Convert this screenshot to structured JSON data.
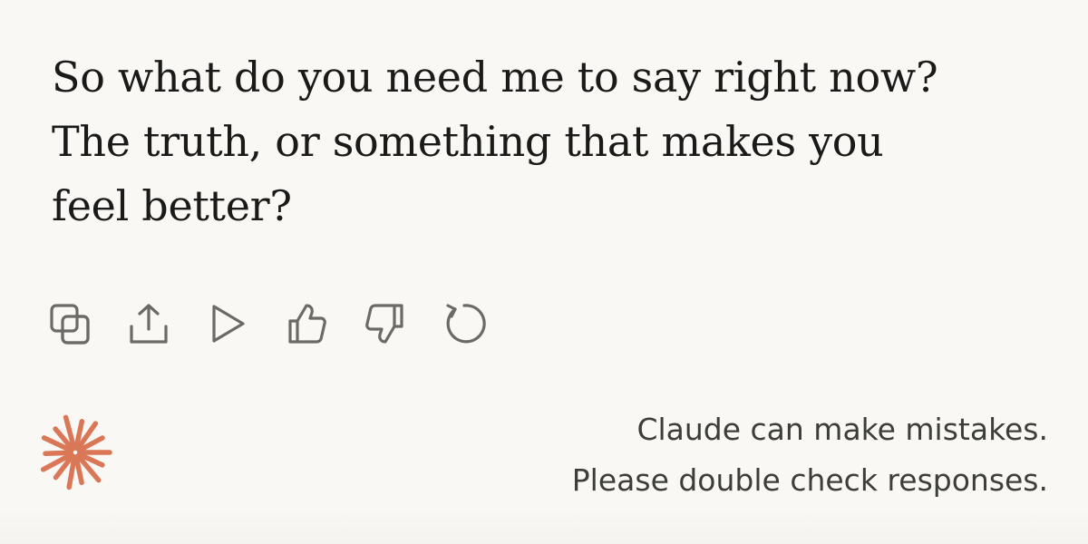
{
  "message": {
    "lines": [
      "So what do you need me to say right now?",
      "The truth, or something that makes you",
      "feel better?"
    ]
  },
  "actions": [
    {
      "name": "copy",
      "icon": "copy-icon"
    },
    {
      "name": "share",
      "icon": "share-icon"
    },
    {
      "name": "play",
      "icon": "play-icon"
    },
    {
      "name": "thumbs-up",
      "icon": "thumbs-up-icon"
    },
    {
      "name": "thumbs-down",
      "icon": "thumbs-down-icon"
    },
    {
      "name": "retry",
      "icon": "retry-icon"
    }
  ],
  "footer": {
    "logo_icon": "claude-starburst-icon",
    "logo_color": "#d97757",
    "disclaimer": {
      "line1": "Claude can make mistakes.",
      "line2": "Please double check responses."
    }
  },
  "colors": {
    "background": "#f9f8f5",
    "text": "#1a1a18",
    "icon": "#6b6a66",
    "disclaimer": "#3d3d3a"
  }
}
